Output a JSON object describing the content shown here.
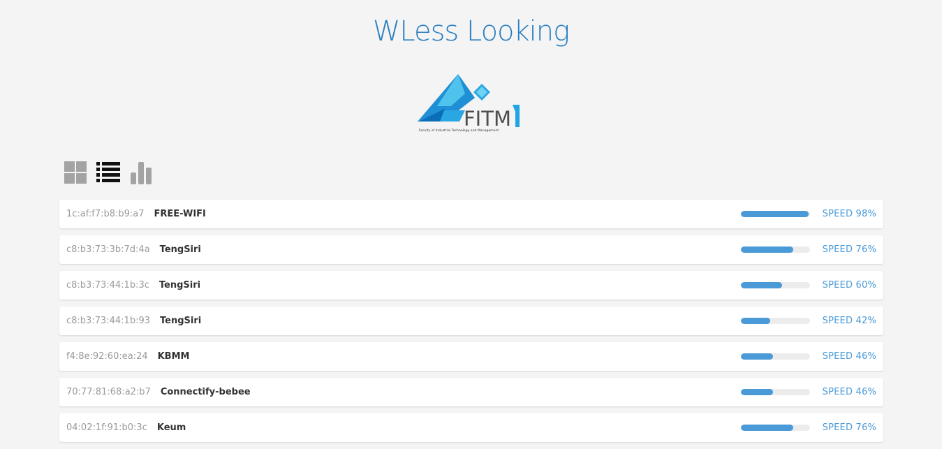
{
  "header": {
    "title": "WLess Looking"
  },
  "logo": {
    "text": "FITM",
    "subtitle": "Faculty of Industrial Technology and Management"
  },
  "view_toggles": [
    {
      "icon": "grid-view-icon",
      "active": false
    },
    {
      "icon": "list-view-icon",
      "active": true
    },
    {
      "icon": "bar-chart-view-icon",
      "active": false
    }
  ],
  "colors": {
    "accent": "#4a9ad8",
    "title": "#2b7fc0",
    "background": "#f4f4f4",
    "toggle_inactive": "#a3a3a3",
    "toggle_active": "#111111"
  },
  "networks": [
    {
      "mac": "1c:af:f7:b8:b9:a7",
      "ssid": "FREE-WIFI",
      "speed": 98,
      "speed_label": "SPEED 98%"
    },
    {
      "mac": "c8:b3:73:3b:7d:4a",
      "ssid": "TengSiri",
      "speed": 76,
      "speed_label": "SPEED 76%"
    },
    {
      "mac": "c8:b3:73:44:1b:3c",
      "ssid": "TengSiri",
      "speed": 60,
      "speed_label": "SPEED 60%"
    },
    {
      "mac": "c8:b3:73:44:1b:93",
      "ssid": "TengSiri",
      "speed": 42,
      "speed_label": "SPEED 42%"
    },
    {
      "mac": "f4:8e:92:60:ea:24",
      "ssid": "KBMM",
      "speed": 46,
      "speed_label": "SPEED 46%"
    },
    {
      "mac": "70:77:81:68:a2:b7",
      "ssid": "Connectify-bebee",
      "speed": 46,
      "speed_label": "SPEED 46%"
    },
    {
      "mac": "04:02:1f:91:b0:3c",
      "ssid": "Keum",
      "speed": 76,
      "speed_label": "SPEED 76%"
    }
  ]
}
